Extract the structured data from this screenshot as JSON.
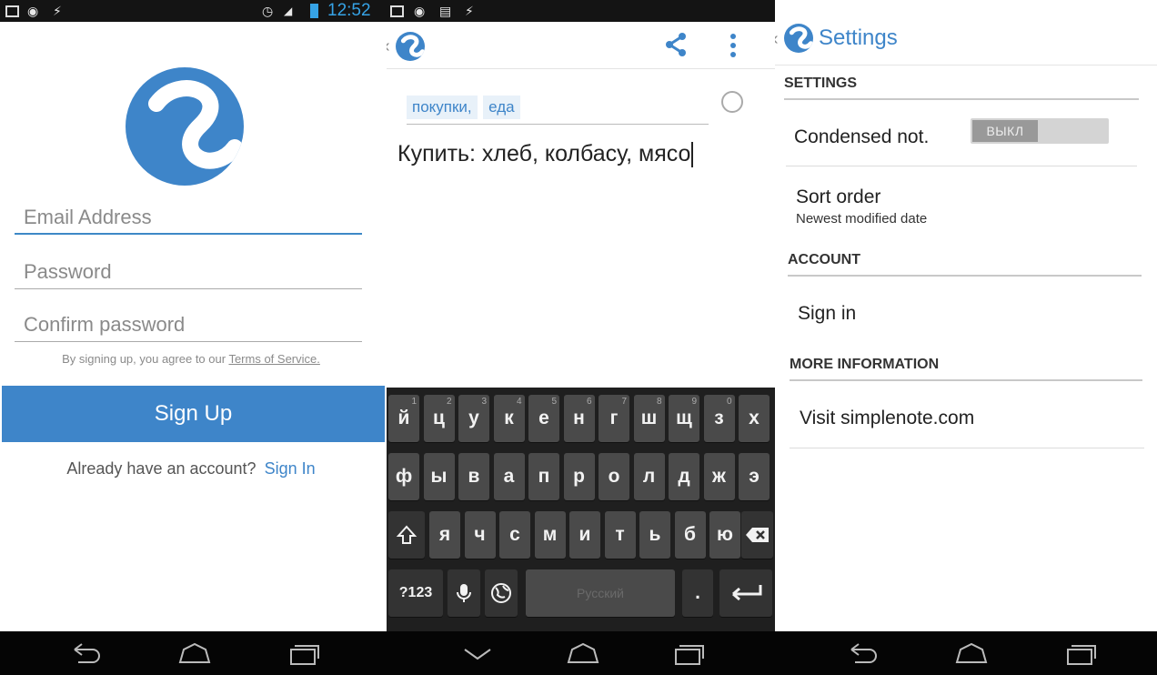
{
  "screen1": {
    "status": {
      "time": "12:52"
    },
    "email_placeholder": "Email Address",
    "password_placeholder": "Password",
    "confirm_placeholder": "Confirm password",
    "terms_prefix": "By signing up, you agree to our",
    "terms_link": "Terms of Service.",
    "signup_label": "Sign Up",
    "already_text": "Already have an account?",
    "signin_link": "Sign In"
  },
  "screen2": {
    "tags": [
      "покупки,",
      "еда"
    ],
    "note_text": "Купить: хлеб, колбасу, мясо",
    "keyboard": {
      "row1": [
        {
          "k": "й",
          "h": "1"
        },
        {
          "k": "ц",
          "h": "2"
        },
        {
          "k": "у",
          "h": "3"
        },
        {
          "k": "к",
          "h": "4"
        },
        {
          "k": "е",
          "h": "5"
        },
        {
          "k": "н",
          "h": "6"
        },
        {
          "k": "г",
          "h": "7"
        },
        {
          "k": "ш",
          "h": "8"
        },
        {
          "k": "щ",
          "h": "9"
        },
        {
          "k": "з",
          "h": "0"
        },
        {
          "k": "х",
          "h": ""
        }
      ],
      "row2": [
        "ф",
        "ы",
        "в",
        "а",
        "п",
        "р",
        "о",
        "л",
        "д",
        "ж",
        "э"
      ],
      "row3": [
        "я",
        "ч",
        "с",
        "м",
        "и",
        "т",
        "ь",
        "б",
        "ю"
      ],
      "symbols_label": "?123",
      "space_label": "Русский",
      "period_label": "."
    }
  },
  "screen3": {
    "title": "Settings",
    "section_settings": "SETTINGS",
    "condensed_label": "Condensed not.",
    "toggle_label": "ВЫКЛ",
    "sort_order_label": "Sort order",
    "sort_order_value": "Newest modified date",
    "section_account": "ACCOUNT",
    "sign_in_label": "Sign in",
    "section_more": "MORE INFORMATION",
    "visit_label": "Visit simplenote.com"
  },
  "colors": {
    "brand_blue": "#3e85c9",
    "status_blue": "#36a3e6",
    "keyboard_bg": "#1f1f1f",
    "key_bg": "#4a4a4a"
  },
  "icons": [
    "image-icon",
    "sync-icon",
    "charging-icon",
    "alarm-icon",
    "signal-icon",
    "battery-icon",
    "back-nav-icon",
    "home-nav-icon",
    "recents-nav-icon",
    "share-icon",
    "overflow-menu-icon",
    "shift-icon",
    "backspace-icon",
    "microphone-icon",
    "globe-icon",
    "enter-icon",
    "chevron-left-icon",
    "simplenote-logo-icon"
  ]
}
